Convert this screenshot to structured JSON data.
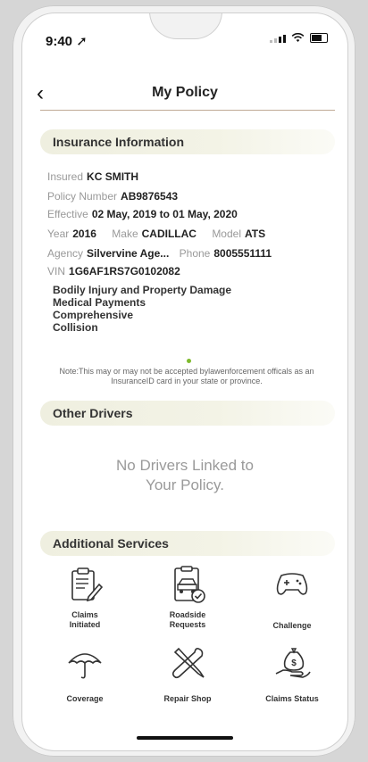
{
  "status": {
    "time": "9:40"
  },
  "header": {
    "title": "My Policy"
  },
  "insurance": {
    "section_title": "Insurance Information",
    "insured_label": "Insured",
    "insured_value": "KC SMITH",
    "policy_label": "Policy Number",
    "policy_value": "AB9876543",
    "effective_label": "Effective",
    "effective_value": "02 May, 2019 to 01 May, 2020",
    "year_label": "Year",
    "year_value": "2016",
    "make_label": "Make",
    "make_value": "CADILLAC",
    "model_label": "Model",
    "model_value": "ATS",
    "agency_label": "Agency",
    "agency_value": "Silvervine Age...",
    "phone_label": "Phone",
    "phone_value": "8005551111",
    "vin_label": "VIN",
    "vin_value": "1G6AF1RS7G0102082",
    "coverages": [
      "Bodily Injury and Property Damage",
      "Medical Payments",
      "Comprehensive",
      "Collision"
    ],
    "note": "Note:This may or may not be accepted bylawenforcement officals as an InsuranceID card in your state or province."
  },
  "other_drivers": {
    "section_title": "Other Drivers",
    "empty_line1": "No Drivers Linked to",
    "empty_line2": "Your Policy."
  },
  "additional_services": {
    "section_title": "Additional Services",
    "items": [
      {
        "label": "Claims\nInitiated",
        "icon": "clipboard-pencil-icon"
      },
      {
        "label": "Roadside\nRequests",
        "icon": "tow-truck-clipboard-icon"
      },
      {
        "label": "Challenge",
        "icon": "gamepad-icon"
      },
      {
        "label": "Coverage",
        "icon": "umbrella-icon"
      },
      {
        "label": "Repair Shop",
        "icon": "wrench-screwdriver-icon"
      },
      {
        "label": "Claims Status",
        "icon": "money-bag-hand-icon"
      }
    ]
  },
  "colors": {
    "accent": "#7fba2e",
    "band": "#efefe0",
    "divider": "#bfa994"
  }
}
